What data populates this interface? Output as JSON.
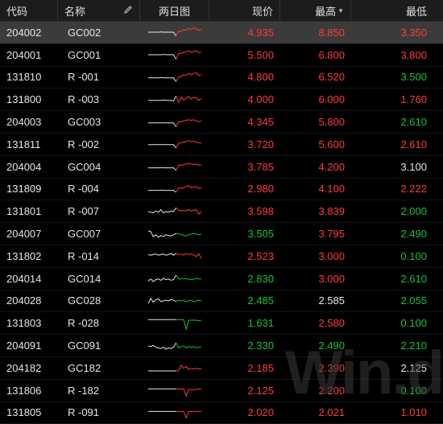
{
  "header": {
    "code": "代码",
    "name": "名称",
    "chart": "两日图",
    "price": "现价",
    "high": "最高",
    "low": "最低",
    "edit_icon": "pencil-icon",
    "sort_icon": "sort-desc-icon"
  },
  "rows": [
    {
      "code": "204002",
      "name": "GC002",
      "price": "4.935",
      "high": "8.850",
      "low": "3.350",
      "price_color": "red",
      "high_color": "red",
      "low_color": "red",
      "selected": true,
      "spark": [
        0.5,
        0.5,
        0.5,
        0.5,
        0.5,
        0.48,
        0.5,
        0.49,
        0.5,
        0.5,
        0.5,
        0.8,
        0.4,
        0.45,
        0.3,
        0.35,
        0.2,
        0.3,
        0.15,
        0.25,
        0.35,
        0.28
      ]
    },
    {
      "code": "204001",
      "name": "GC001",
      "price": "5.500",
      "high": "6.800",
      "low": "3.800",
      "price_color": "red",
      "high_color": "red",
      "low_color": "red",
      "selected": false,
      "spark": [
        0.5,
        0.5,
        0.5,
        0.5,
        0.5,
        0.5,
        0.48,
        0.5,
        0.5,
        0.5,
        0.5,
        0.85,
        0.4,
        0.4,
        0.3,
        0.3,
        0.2,
        0.3,
        0.25,
        0.2,
        0.35,
        0.3
      ]
    },
    {
      "code": "131810",
      "name": "R -001",
      "price": "4.800",
      "high": "6.520",
      "low": "3.500",
      "price_color": "red",
      "high_color": "red",
      "low_color": "green",
      "selected": false,
      "spark": [
        0.55,
        0.55,
        0.55,
        0.55,
        0.55,
        0.52,
        0.55,
        0.55,
        0.55,
        0.55,
        0.55,
        0.85,
        0.45,
        0.45,
        0.3,
        0.35,
        0.2,
        0.3,
        0.2,
        0.15,
        0.35,
        0.3
      ]
    },
    {
      "code": "131800",
      "name": "R -003",
      "price": "4.000",
      "high": "6.000",
      "low": "1.760",
      "price_color": "red",
      "high_color": "red",
      "low_color": "red",
      "selected": false,
      "spark": [
        0.55,
        0.55,
        0.55,
        0.55,
        0.55,
        0.55,
        0.52,
        0.55,
        0.55,
        0.55,
        0.6,
        0.2,
        0.7,
        0.3,
        0.5,
        0.4,
        0.25,
        0.45,
        0.3,
        0.35,
        0.55,
        0.4
      ]
    },
    {
      "code": "204003",
      "name": "GC003",
      "price": "4.345",
      "high": "5.800",
      "low": "2.610",
      "price_color": "red",
      "high_color": "red",
      "low_color": "green",
      "selected": false,
      "spark": [
        0.55,
        0.55,
        0.55,
        0.55,
        0.55,
        0.55,
        0.55,
        0.55,
        0.55,
        0.55,
        0.55,
        0.85,
        0.45,
        0.45,
        0.4,
        0.35,
        0.3,
        0.35,
        0.3,
        0.4,
        0.45,
        0.4
      ]
    },
    {
      "code": "131811",
      "name": "R -002",
      "price": "3.720",
      "high": "5.600",
      "low": "2.610",
      "price_color": "red",
      "high_color": "red",
      "low_color": "red",
      "selected": false,
      "spark": [
        0.55,
        0.55,
        0.55,
        0.55,
        0.55,
        0.55,
        0.55,
        0.55,
        0.55,
        0.55,
        0.55,
        0.8,
        0.45,
        0.4,
        0.35,
        0.3,
        0.25,
        0.3,
        0.3,
        0.35,
        0.4,
        0.45
      ]
    },
    {
      "code": "204004",
      "name": "GC004",
      "price": "3.785",
      "high": "4.200",
      "low": "3.100",
      "price_color": "red",
      "high_color": "red",
      "low_color": "white",
      "selected": false,
      "spark": [
        0.6,
        0.6,
        0.6,
        0.6,
        0.6,
        0.58,
        0.6,
        0.6,
        0.6,
        0.6,
        0.6,
        0.8,
        0.4,
        0.4,
        0.35,
        0.3,
        0.25,
        0.3,
        0.35,
        0.3,
        0.4,
        0.35
      ]
    },
    {
      "code": "131809",
      "name": "R -004",
      "price": "2.980",
      "high": "4.100",
      "low": "2.222",
      "price_color": "red",
      "high_color": "red",
      "low_color": "red",
      "selected": false,
      "spark": [
        0.6,
        0.6,
        0.6,
        0.6,
        0.6,
        0.58,
        0.6,
        0.6,
        0.6,
        0.6,
        0.6,
        0.75,
        0.4,
        0.45,
        0.4,
        0.3,
        0.25,
        0.4,
        0.35,
        0.3,
        0.45,
        0.4
      ]
    },
    {
      "code": "131801",
      "name": "R -007",
      "price": "3.598",
      "high": "3.839",
      "low": "2.000",
      "price_color": "red",
      "high_color": "red",
      "low_color": "green",
      "selected": false,
      "spark": [
        0.5,
        0.55,
        0.6,
        0.45,
        0.55,
        0.35,
        0.6,
        0.5,
        0.55,
        0.45,
        0.5,
        0.2,
        0.4,
        0.45,
        0.4,
        0.45,
        0.35,
        0.45,
        0.4,
        0.35,
        0.7,
        0.5
      ]
    },
    {
      "code": "204007",
      "name": "GC007",
      "price": "3.505",
      "high": "3.795",
      "low": "2.490",
      "price_color": "green",
      "high_color": "red",
      "low_color": "green",
      "selected": false,
      "spark": [
        0.25,
        0.3,
        0.7,
        0.55,
        0.75,
        0.6,
        0.7,
        0.55,
        0.6,
        0.65,
        0.55,
        0.45,
        0.45,
        0.55,
        0.6,
        0.65,
        0.55,
        0.5,
        0.45,
        0.5,
        0.55,
        0.5
      ]
    },
    {
      "code": "131802",
      "name": "R -014",
      "price": "2.523",
      "high": "3.000",
      "low": "0.100",
      "price_color": "red",
      "high_color": "red",
      "low_color": "green",
      "selected": false,
      "spark": [
        0.4,
        0.45,
        0.4,
        0.35,
        0.45,
        0.4,
        0.35,
        0.45,
        0.4,
        0.3,
        0.45,
        0.3,
        0.4,
        0.35,
        0.45,
        0.3,
        0.4,
        0.35,
        0.45,
        0.55,
        0.35,
        0.7
      ]
    },
    {
      "code": "204014",
      "name": "GC014",
      "price": "2.830",
      "high": "3.000",
      "low": "2.610",
      "price_color": "green",
      "high_color": "red",
      "low_color": "green",
      "selected": false,
      "spark": [
        0.7,
        0.55,
        0.75,
        0.6,
        0.55,
        0.65,
        0.5,
        0.6,
        0.55,
        0.65,
        0.6,
        0.25,
        0.55,
        0.55,
        0.5,
        0.55,
        0.55,
        0.6,
        0.55,
        0.5,
        0.55,
        0.55
      ]
    },
    {
      "code": "204028",
      "name": "GC028",
      "price": "2.485",
      "high": "2.585",
      "low": "2.055",
      "price_color": "green",
      "high_color": "white",
      "low_color": "green",
      "selected": false,
      "spark": [
        0.7,
        0.3,
        0.6,
        0.4,
        0.35,
        0.55,
        0.5,
        0.45,
        0.5,
        0.4,
        0.45,
        0.55,
        0.45,
        0.5,
        0.45,
        0.55,
        0.5,
        0.45,
        0.55,
        0.5,
        0.45,
        0.5
      ]
    },
    {
      "code": "131803",
      "name": "R -028",
      "price": "1.631",
      "high": "2.580",
      "low": "0.100",
      "price_color": "green",
      "high_color": "red",
      "low_color": "green",
      "selected": false,
      "spark": [
        0.2,
        0.2,
        0.2,
        0.2,
        0.2,
        0.2,
        0.2,
        0.2,
        0.2,
        0.2,
        0.2,
        0.2,
        0.2,
        0.2,
        0.2,
        0.95,
        0.25,
        0.25,
        0.25,
        0.25,
        0.3,
        0.25
      ]
    },
    {
      "code": "204091",
      "name": "GC091",
      "price": "2.330",
      "high": "2.490",
      "low": "2.210",
      "price_color": "green",
      "high_color": "green",
      "low_color": "green",
      "selected": false,
      "spark": [
        0.5,
        0.55,
        0.45,
        0.6,
        0.65,
        0.7,
        0.6,
        0.75,
        0.65,
        0.7,
        0.6,
        0.25,
        0.65,
        0.55,
        0.5,
        0.65,
        0.55,
        0.6,
        0.55,
        0.65,
        0.6,
        0.55
      ]
    },
    {
      "code": "204182",
      "name": "GC182",
      "price": "2.185",
      "high": "2.390",
      "low": "2.125",
      "price_color": "red",
      "high_color": "red",
      "low_color": "white",
      "selected": false,
      "spark": [
        0.75,
        0.75,
        0.75,
        0.75,
        0.75,
        0.75,
        0.75,
        0.75,
        0.75,
        0.75,
        0.75,
        0.75,
        0.75,
        0.3,
        0.55,
        0.4,
        0.65,
        0.55,
        0.6,
        0.55,
        0.6,
        0.55
      ]
    },
    {
      "code": "131806",
      "name": "R -182",
      "price": "2.125",
      "high": "2.200",
      "low": "0.100",
      "price_color": "red",
      "high_color": "red",
      "low_color": "green",
      "selected": false,
      "spark": [
        0.4,
        0.4,
        0.4,
        0.4,
        0.4,
        0.4,
        0.4,
        0.4,
        0.4,
        0.4,
        0.4,
        0.4,
        0.4,
        0.4,
        0.4,
        0.95,
        0.45,
        0.45,
        0.45,
        0.45,
        0.4,
        0.4
      ]
    },
    {
      "code": "131805",
      "name": "R -091",
      "price": "2.020",
      "high": "2.021",
      "low": "1.010",
      "price_color": "red",
      "high_color": "red",
      "low_color": "red",
      "selected": false,
      "spark": [
        0.4,
        0.4,
        0.4,
        0.4,
        0.4,
        0.4,
        0.4,
        0.4,
        0.4,
        0.4,
        0.4,
        0.4,
        0.4,
        0.4,
        0.4,
        0.9,
        0.4,
        0.4,
        0.4,
        0.4,
        0.4,
        0.4
      ]
    }
  ],
  "watermark": "Win.d",
  "colors": {
    "up": "#ff3b3b",
    "down": "#18c23b",
    "flat": "#e8e8e8",
    "selected_bg": "#3b3b3b"
  }
}
